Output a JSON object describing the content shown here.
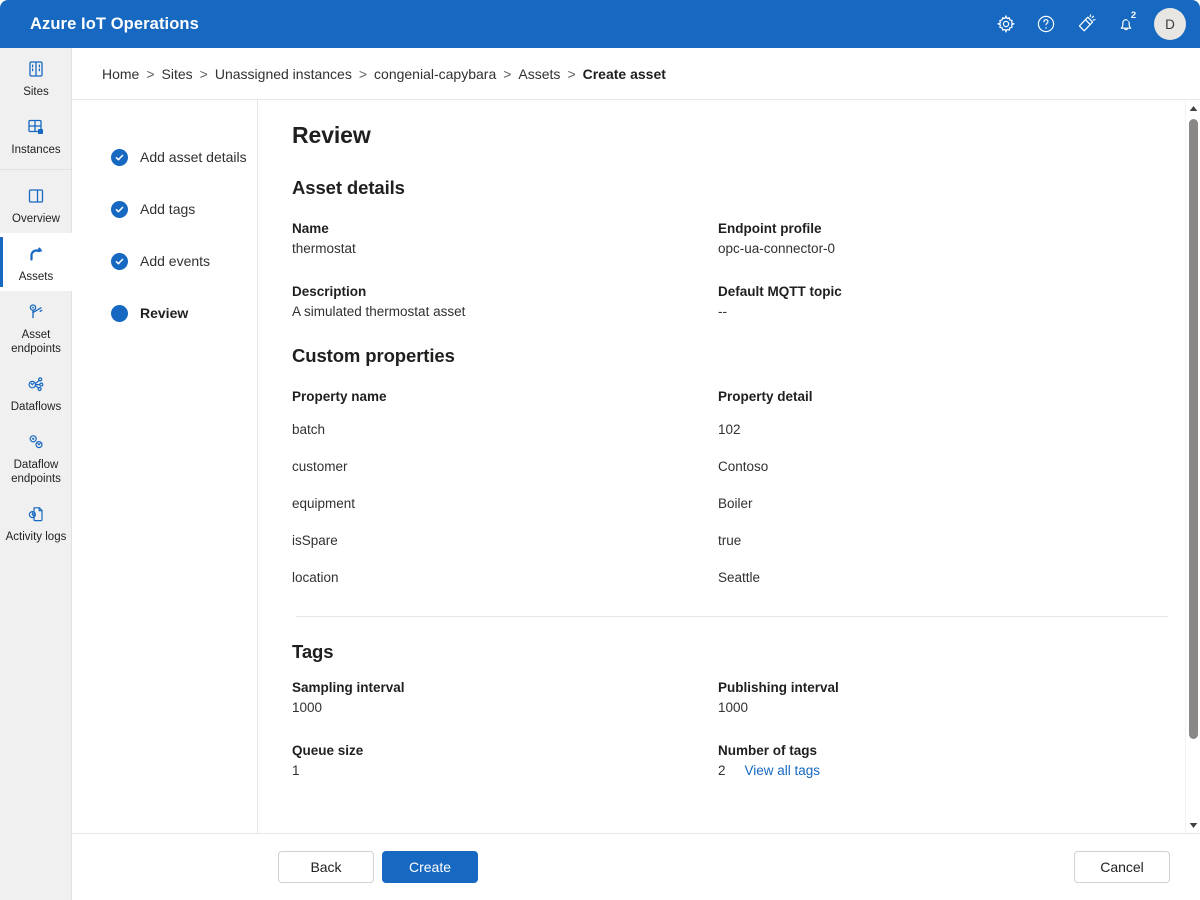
{
  "header": {
    "brand": "Azure IoT Operations",
    "icons": [
      {
        "name": "gear-icon",
        "label": "Settings"
      },
      {
        "name": "help-icon",
        "label": "Help"
      },
      {
        "name": "feedback-icon",
        "label": "Feedback"
      },
      {
        "name": "bell-icon",
        "label": "Notifications"
      }
    ],
    "notification_count": "2",
    "avatar_initial": "D",
    "background_color": "#1668c1"
  },
  "rail": {
    "items": [
      {
        "label": "Sites",
        "icon": "sites-icon",
        "active": false
      },
      {
        "label": "Instances",
        "icon": "instances-icon",
        "active": false
      },
      {
        "label": "Overview",
        "icon": "overview-icon",
        "active": false
      },
      {
        "label": "Assets",
        "icon": "assets-icon",
        "active": true
      },
      {
        "label": "Asset endpoints",
        "icon": "asset-endpoints-icon",
        "active": false
      },
      {
        "label": "Dataflows",
        "icon": "dataflows-icon",
        "active": false
      },
      {
        "label": "Dataflow endpoints",
        "icon": "dataflow-endpoints-icon",
        "active": false
      },
      {
        "label": "Activity logs",
        "icon": "activity-logs-icon",
        "active": false
      }
    ]
  },
  "breadcrumb": {
    "separator": ">",
    "items": [
      "Home",
      "Sites",
      "Unassigned instances",
      "congenial-capybara",
      "Assets"
    ],
    "current": "Create asset"
  },
  "wizard": {
    "steps": [
      {
        "label": "Add asset details",
        "state": "complete"
      },
      {
        "label": "Add tags",
        "state": "complete"
      },
      {
        "label": "Add events",
        "state": "complete"
      },
      {
        "label": "Review",
        "state": "current"
      }
    ]
  },
  "review": {
    "title": "Review",
    "asset_details": {
      "heading": "Asset details",
      "fields": [
        {
          "label": "Name",
          "value": "thermostat"
        },
        {
          "label": "Endpoint profile",
          "value": "opc-ua-connector-0"
        },
        {
          "label": "Description",
          "value": "A simulated thermostat asset"
        },
        {
          "label": "Default MQTT topic",
          "value": "--"
        }
      ]
    },
    "custom_properties": {
      "heading": "Custom properties",
      "columns": [
        "Property name",
        "Property detail"
      ],
      "rows": [
        [
          "batch",
          "102"
        ],
        [
          "customer",
          "Contoso"
        ],
        [
          "equipment",
          "Boiler"
        ],
        [
          "isSpare",
          "true"
        ],
        [
          "location",
          "Seattle"
        ]
      ]
    },
    "tags": {
      "heading": "Tags",
      "sampling_interval_label": "Sampling interval",
      "sampling_interval_value": "1000",
      "publishing_interval_label": "Publishing interval",
      "publishing_interval_value": "1000",
      "queue_size_label": "Queue size",
      "queue_size_value": "1",
      "number_of_tags_label": "Number of tags",
      "number_of_tags_value": "2",
      "view_all_tags_link": "View all tags"
    }
  },
  "actions": {
    "back": "Back",
    "create": "Create",
    "cancel": "Cancel"
  },
  "colors": {
    "accent": "#1668c1",
    "link": "#1668c1",
    "text": "#201f1e"
  }
}
